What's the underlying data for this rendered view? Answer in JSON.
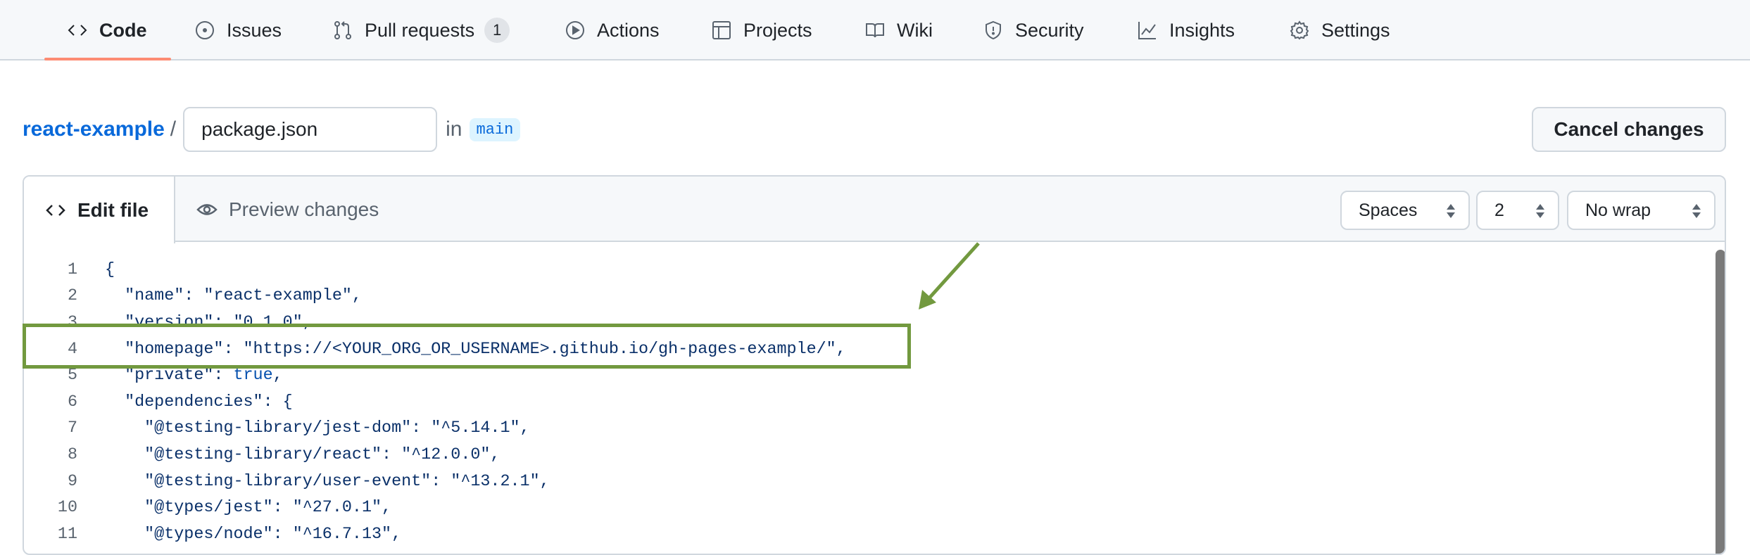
{
  "nav": {
    "tabs": [
      {
        "label": "Code",
        "icon": "code-icon",
        "active": true
      },
      {
        "label": "Issues",
        "icon": "issue-icon"
      },
      {
        "label": "Pull requests",
        "icon": "pull-request-icon",
        "count": "1"
      },
      {
        "label": "Actions",
        "icon": "play-icon"
      },
      {
        "label": "Projects",
        "icon": "table-icon"
      },
      {
        "label": "Wiki",
        "icon": "book-icon"
      },
      {
        "label": "Security",
        "icon": "shield-icon"
      },
      {
        "label": "Insights",
        "icon": "graph-icon"
      },
      {
        "label": "Settings",
        "icon": "gear-icon"
      }
    ],
    "active_color": "#fd8c73"
  },
  "breadcrumb": {
    "repo": "react-example",
    "separator": "/",
    "filename": "package.json",
    "in": "in",
    "branch": "main"
  },
  "cancel_label": "Cancel changes",
  "editor": {
    "tabs": [
      {
        "label": "Edit file",
        "icon": "code-icon"
      },
      {
        "label": "Preview changes",
        "icon": "eye-icon"
      }
    ],
    "indent_mode": "Spaces",
    "indent_size": "2",
    "wrap_mode": "No wrap",
    "lines": [
      {
        "n": "1",
        "t": "{"
      },
      {
        "n": "2",
        "t": "  \"name\": \"react-example\","
      },
      {
        "n": "3",
        "t": "  \"version\": \"0.1.0\","
      },
      {
        "n": "4",
        "t": "  \"homepage\": \"https://<YOUR_ORG_OR_USERNAME>.github.io/gh-pages-example/\","
      },
      {
        "n": "5",
        "t": "  \"private\": ",
        "kw": "true",
        "after": ","
      },
      {
        "n": "6",
        "t": "  \"dependencies\": {"
      },
      {
        "n": "7",
        "t": "    \"@testing-library/jest-dom\": \"^5.14.1\","
      },
      {
        "n": "8",
        "t": "    \"@testing-library/react\": \"^12.0.0\","
      },
      {
        "n": "9",
        "t": "    \"@testing-library/user-event\": \"^13.2.1\","
      },
      {
        "n": "10",
        "t": "    \"@types/jest\": \"^27.0.1\","
      },
      {
        "n": "11",
        "t": "    \"@types/node\": \"^16.7.13\","
      }
    ]
  },
  "annotation": {
    "color": "#72993f",
    "highlighted_line": "4"
  }
}
